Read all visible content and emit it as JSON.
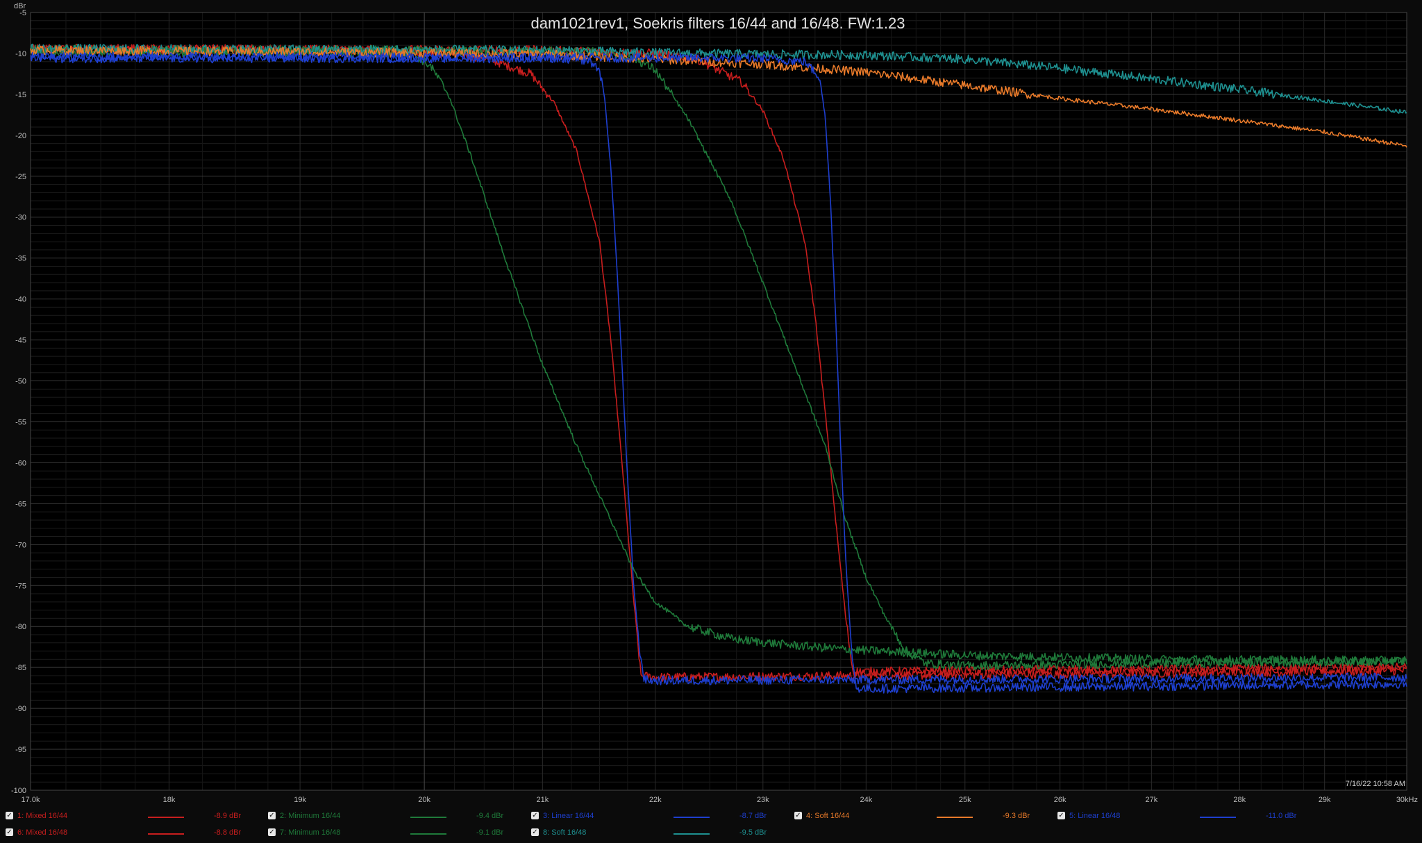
{
  "chart_data": {
    "type": "line",
    "title": "dam1021rev1, Soekris filters 16/44 and 16/48. FW:1.23",
    "ylabel": "dBr",
    "xunit": "kHz",
    "xscale": "log",
    "xlim": [
      17000,
      30000
    ],
    "ylim": [
      -100,
      -5
    ],
    "x_ticks": [
      17000,
      18000,
      19000,
      20000,
      21000,
      22000,
      23000,
      24000,
      25000,
      26000,
      27000,
      28000,
      29000,
      30000
    ],
    "x_tick_labels": [
      "17.0k",
      "18k",
      "19k",
      "20k",
      "21k",
      "22k",
      "23k",
      "24k",
      "25k",
      "26k",
      "27k",
      "28k",
      "29k",
      "30kHz"
    ],
    "y_ticks": [
      -5,
      -10,
      -15,
      -20,
      -25,
      -30,
      -35,
      -40,
      -45,
      -50,
      -55,
      -60,
      -65,
      -70,
      -75,
      -80,
      -85,
      -90,
      -95,
      -100
    ],
    "y_tick_labels": [
      "-5",
      "-10",
      "-15",
      "-20",
      "-25",
      "-30",
      "-35",
      "-40",
      "-45",
      "-50",
      "-55",
      "-60",
      "-65",
      "-70",
      "-75",
      "-80",
      "-85",
      "-90",
      "-95",
      "-100"
    ],
    "grid": true,
    "timestamp": "7/16/22 10:58 AM",
    "series": [
      {
        "name": "1: Mixed 16/44",
        "color": "#c81e1e",
        "value_label": "-8.9 dBr",
        "x": [
          17000,
          19000,
          20000,
          20500,
          20900,
          21100,
          21300,
          21500,
          21600,
          21700,
          21800,
          21870,
          22000,
          24000,
          26000,
          28000,
          30000
        ],
        "y": [
          -9.5,
          -9.6,
          -9.8,
          -10.5,
          -12.5,
          -16,
          -22,
          -33,
          -45,
          -60,
          -76,
          -86,
          -86.2,
          -86,
          -85.8,
          -85.6,
          -85.4
        ]
      },
      {
        "name": "6: Mixed 16/48",
        "color": "#c81e1e",
        "value_label": "-8.8 dBr",
        "x": [
          17000,
          19000,
          21000,
          22000,
          22400,
          22800,
          23000,
          23200,
          23400,
          23500,
          23600,
          23700,
          23800,
          23870,
          24000,
          26000,
          28000,
          30000
        ],
        "y": [
          -9.4,
          -9.5,
          -9.6,
          -10,
          -10.8,
          -13.5,
          -17,
          -23,
          -33,
          -42,
          -54,
          -67,
          -79,
          -85.5,
          -85.5,
          -85.3,
          -85.1,
          -85
        ]
      },
      {
        "name": "2: Minimum 16/44",
        "color": "#1f7a3a",
        "value_label": "-9.4 dBr",
        "x": [
          17000,
          19000,
          19900,
          20050,
          20200,
          20400,
          20700,
          21000,
          21300,
          21600,
          21800,
          22000,
          22300,
          22700,
          23200,
          23800,
          25000,
          27000,
          30000
        ],
        "y": [
          -9.8,
          -9.9,
          -10,
          -11.5,
          -15,
          -23,
          -36,
          -48,
          -58,
          -67,
          -73,
          -77,
          -80,
          -81.5,
          -82.2,
          -82.8,
          -83.5,
          -84,
          -84.2
        ]
      },
      {
        "name": "7: Minimum 16/48",
        "color": "#1f7a3a",
        "value_label": "-9.1 dBr",
        "x": [
          17000,
          20000,
          21500,
          21800,
          22000,
          22300,
          22700,
          23000,
          23300,
          23600,
          23800,
          24000,
          24200,
          24400,
          24600,
          25000,
          27000,
          30000
        ],
        "y": [
          -9.5,
          -9.6,
          -9.8,
          -10.5,
          -12,
          -18,
          -28,
          -38,
          -48,
          -58,
          -67,
          -74,
          -79,
          -83,
          -84.5,
          -84.8,
          -84.5,
          -84.2
        ]
      },
      {
        "name": "3: Linear 16/44",
        "color": "#1e3fcf",
        "value_label": "-8.7 dBr",
        "x": [
          17000,
          19000,
          21000,
          21400,
          21500,
          21550,
          21600,
          21650,
          21700,
          21750,
          21800,
          21850,
          21900,
          22000,
          24000,
          26000,
          28000,
          30000
        ],
        "y": [
          -10.6,
          -10.6,
          -10.6,
          -10.8,
          -12,
          -16,
          -24,
          -35,
          -48,
          -62,
          -74,
          -82,
          -86.5,
          -86.6,
          -86.5,
          -86.4,
          -86.3,
          -86.2
        ]
      },
      {
        "name": "8: Soft 16/48",
        "color": "#1e9090",
        "value_label": "-9.5 dBr",
        "x": [
          17000,
          19000,
          21000,
          22000,
          23000,
          24000,
          25000,
          26000,
          27000,
          28000,
          29000,
          30000
        ],
        "y": [
          -9.4,
          -9.5,
          -9.6,
          -9.9,
          -10.1,
          -10.2,
          -10.7,
          -11.8,
          -13.1,
          -14.4,
          -15.8,
          -17.2
        ]
      },
      {
        "name": "4: Soft 16/44",
        "color": "#e87a2a",
        "value_label": "-9.3 dBr",
        "x": [
          17000,
          19000,
          21000,
          22000,
          23000,
          24000,
          25000,
          26000,
          27000,
          28000,
          29000,
          30000
        ],
        "y": [
          -9.6,
          -9.8,
          -10.1,
          -10.7,
          -11.3,
          -12.3,
          -13.9,
          -15.5,
          -16.8,
          -18.2,
          -19.6,
          -21.3
        ]
      },
      {
        "name": "5: Linear 16/48",
        "color": "#1e3fcf",
        "value_label": "-11.0 dBr",
        "x": [
          17000,
          19000,
          21000,
          23000,
          23400,
          23550,
          23600,
          23650,
          23700,
          23750,
          23800,
          23850,
          23900,
          24000,
          26000,
          28000,
          30000
        ],
        "y": [
          -10.4,
          -10.4,
          -10.5,
          -10.6,
          -11,
          -13,
          -18,
          -28,
          -42,
          -58,
          -72,
          -82,
          -87.5,
          -87.6,
          -87.4,
          -87.2,
          -87
        ]
      }
    ]
  },
  "legend": {
    "row1": [
      {
        "series": 0,
        "label": "1: Mixed 16/44",
        "value": "-8.9 dBr"
      },
      {
        "series": 2,
        "label": "2: Minimum 16/44",
        "value": "-9.4 dBr"
      },
      {
        "series": 4,
        "label": "3: Linear 16/44",
        "value": "-8.7 dBr"
      },
      {
        "series": 6,
        "label": "4: Soft 16/44",
        "value": "-9.3 dBr"
      },
      {
        "series": 7,
        "label": "5: Linear 16/48",
        "value": "-11.0 dBr"
      }
    ],
    "row2": [
      {
        "series": 1,
        "label": "6: Mixed 16/48",
        "value": "-8.8 dBr"
      },
      {
        "series": 3,
        "label": "7: Minimum 16/48",
        "value": "-9.1 dBr"
      },
      {
        "series": 5,
        "label": "8: Soft 16/48",
        "value": "-9.5 dBr"
      }
    ],
    "check_glyph": "✓"
  }
}
